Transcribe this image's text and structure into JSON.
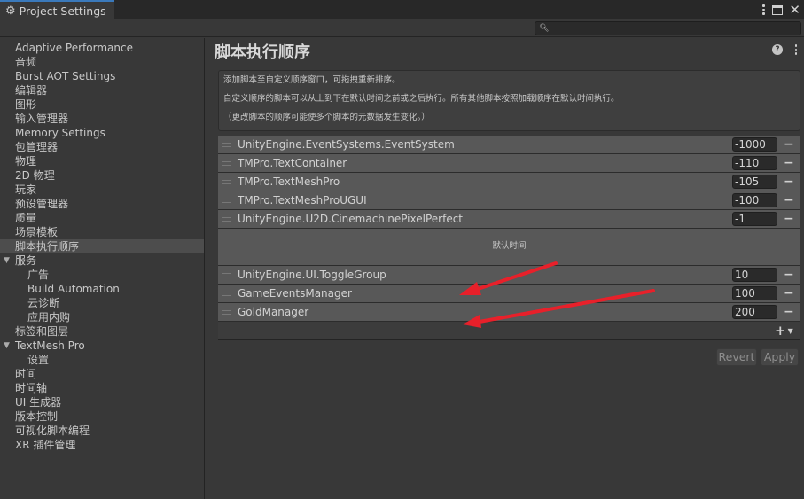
{
  "window": {
    "tab_title": "Project Settings",
    "tab_icon": "gear-icon",
    "search": {
      "placeholder": "",
      "value": ""
    }
  },
  "sidebar": {
    "items": [
      {
        "label": "Adaptive Performance",
        "level": 0
      },
      {
        "label": "音频",
        "level": 0
      },
      {
        "label": "Burst AOT Settings",
        "level": 0
      },
      {
        "label": "编辑器",
        "level": 0
      },
      {
        "label": "图形",
        "level": 0
      },
      {
        "label": "输入管理器",
        "level": 0
      },
      {
        "label": "Memory Settings",
        "level": 0
      },
      {
        "label": "包管理器",
        "level": 0
      },
      {
        "label": "物理",
        "level": 0
      },
      {
        "label": "2D 物理",
        "level": 0
      },
      {
        "label": "玩家",
        "level": 0
      },
      {
        "label": "预设管理器",
        "level": 0
      },
      {
        "label": "质量",
        "level": 0
      },
      {
        "label": "场景模板",
        "level": 0
      },
      {
        "label": "脚本执行顺序",
        "level": 0,
        "selected": true
      },
      {
        "label": "服务",
        "level": 0,
        "expanded": true
      },
      {
        "label": "广告",
        "level": 1
      },
      {
        "label": "Build Automation",
        "level": 1
      },
      {
        "label": "云诊断",
        "level": 1
      },
      {
        "label": "应用内购",
        "level": 1
      },
      {
        "label": "标签和图层",
        "level": 0
      },
      {
        "label": "TextMesh Pro",
        "level": 0,
        "expanded": true
      },
      {
        "label": "设置",
        "level": 1
      },
      {
        "label": "时间",
        "level": 0
      },
      {
        "label": "时间轴",
        "level": 0
      },
      {
        "label": "UI 生成器",
        "level": 0
      },
      {
        "label": "版本控制",
        "level": 0
      },
      {
        "label": "可视化脚本编程",
        "level": 0
      },
      {
        "label": "XR 插件管理",
        "level": 0
      }
    ]
  },
  "main": {
    "title": "脚本执行顺序",
    "info": [
      "添加脚本至自定义顺序窗口，可拖拽重新排序。",
      "自定义顺序的脚本可以从上到下在默认时间之前或之后执行。所有其他脚本按照加载顺序在默认时间执行。",
      "（更改脚本的顺序可能使多个脚本的元数据发生变化。）"
    ],
    "before_default": [
      {
        "name": "UnityEngine.EventSystems.EventSystem",
        "order": "-1000"
      },
      {
        "name": "TMPro.TextContainer",
        "order": "-110"
      },
      {
        "name": "TMPro.TextMeshPro",
        "order": "-105"
      },
      {
        "name": "TMPro.TextMeshProUGUI",
        "order": "-100"
      },
      {
        "name": "UnityEngine.U2D.CinemachinePixelPerfect",
        "order": "-1"
      }
    ],
    "default_time_label": "默认时间",
    "after_default": [
      {
        "name": "UnityEngine.UI.ToggleGroup",
        "order": "10"
      },
      {
        "name": "GameEventsManager",
        "order": "100"
      },
      {
        "name": "GoldManager",
        "order": "200"
      }
    ],
    "remove_symbol": "−",
    "add_symbol": "+",
    "revert_label": "Revert",
    "apply_label": "Apply"
  },
  "annotations": {
    "arrow_color": "#e8202a",
    "arrow_count": 2
  }
}
